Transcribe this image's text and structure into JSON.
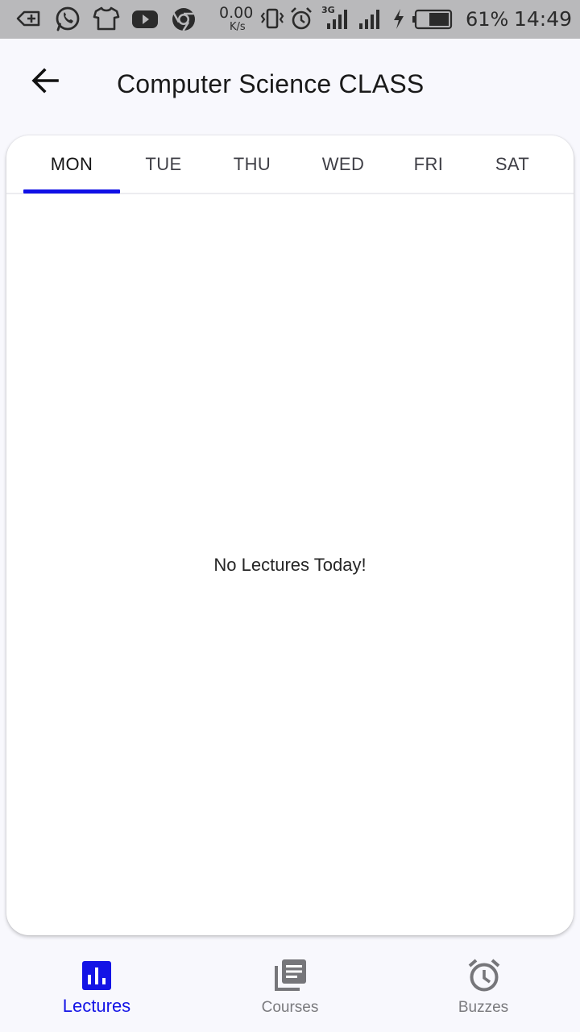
{
  "status_bar": {
    "net_speed": "0.00",
    "net_speed_unit": "K/s",
    "network_type": "3G",
    "battery_percent": "61%",
    "time": "14:49"
  },
  "header": {
    "title": "Computer Science CLASS",
    "back_icon": "arrow-left-icon"
  },
  "tabs": [
    {
      "label": "MON",
      "active": true
    },
    {
      "label": "TUE",
      "active": false
    },
    {
      "label": "THU",
      "active": false
    },
    {
      "label": "WED",
      "active": false
    },
    {
      "label": "FRI",
      "active": false
    },
    {
      "label": "SAT",
      "active": false
    }
  ],
  "content": {
    "empty_message": "No Lectures Today!"
  },
  "bottom_nav": [
    {
      "label": "Lectures",
      "icon": "bar-chart-icon",
      "active": true
    },
    {
      "label": "Courses",
      "icon": "library-books-icon",
      "active": false
    },
    {
      "label": "Buzzes",
      "icon": "alarm-clock-icon",
      "active": false
    }
  ],
  "colors": {
    "accent": "#1010e6",
    "inactive": "#7a7a7e",
    "status_bar": "#b9b9bb",
    "background": "#f8f8fd"
  }
}
